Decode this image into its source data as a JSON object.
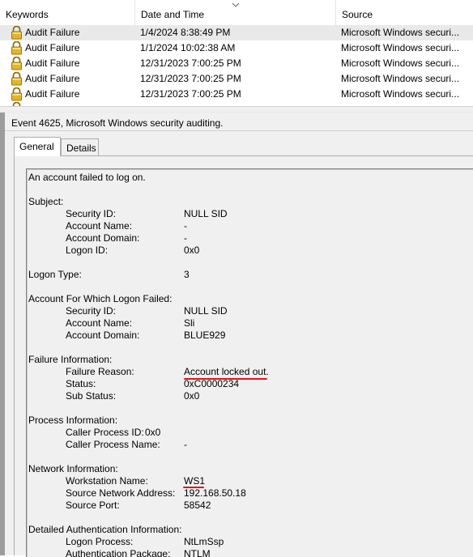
{
  "list": {
    "columns": {
      "keywords": "Keywords",
      "date_time": "Date and Time",
      "source": "Source"
    },
    "rows": [
      {
        "keywords": "Audit Failure",
        "date_time": "1/4/2024 8:38:49 PM",
        "source": "Microsoft Windows securi...",
        "selected": true
      },
      {
        "keywords": "Audit Failure",
        "date_time": "1/1/2024 10:02:38 AM",
        "source": "Microsoft Windows securi...",
        "selected": false
      },
      {
        "keywords": "Audit Failure",
        "date_time": "12/31/2023 7:00:25 PM",
        "source": "Microsoft Windows securi...",
        "selected": false
      },
      {
        "keywords": "Audit Failure",
        "date_time": "12/31/2023 7:00:25 PM",
        "source": "Microsoft Windows securi...",
        "selected": false
      },
      {
        "keywords": "Audit Failure",
        "date_time": "12/31/2023 7:00:25 PM",
        "source": "Microsoft Windows securi...",
        "selected": false
      }
    ],
    "row_icon": "padlock-icon",
    "sort_icon": "chevron-down-icon"
  },
  "detail": {
    "event_title": "Event 4625, Microsoft Windows security auditing.",
    "tabs": {
      "general": "General",
      "details": "Details"
    },
    "message": {
      "intro": "An account failed to log on.",
      "subject": {
        "heading": "Subject:",
        "security_id_label": "Security ID:",
        "security_id": "NULL SID",
        "account_name_label": "Account Name:",
        "account_name": "-",
        "account_domain_label": "Account Domain:",
        "account_domain": "-",
        "logon_id_label": "Logon ID:",
        "logon_id": "0x0"
      },
      "logon_type_label": "Logon Type:",
      "logon_type": "3",
      "account_failed": {
        "heading": "Account For Which Logon Failed:",
        "security_id_label": "Security ID:",
        "security_id": "NULL SID",
        "account_name_label": "Account Name:",
        "account_name": "Sli",
        "account_domain_label": "Account Domain:",
        "account_domain": "BLUE929"
      },
      "failure": {
        "heading": "Failure Information:",
        "reason_label": "Failure Reason:",
        "reason": "Account locked out.",
        "status_label": "Status:",
        "status": "0xC0000234",
        "sub_status_label": "Sub Status:",
        "sub_status": "0x0"
      },
      "process": {
        "heading": "Process Information:",
        "caller_pid_label": "Caller Process ID:",
        "caller_pid": "0x0",
        "caller_name_label": "Caller Process Name:",
        "caller_name": "-"
      },
      "network": {
        "heading": "Network Information:",
        "workstation_label": "Workstation Name:",
        "workstation": "WS1",
        "src_addr_label": "Source Network Address:",
        "src_addr": "192.168.50.18",
        "src_port_label": "Source Port:",
        "src_port": "58542"
      },
      "auth": {
        "heading": "Detailed Authentication Information:",
        "logon_process_label": "Logon Process:",
        "logon_process": "NtLmSsp",
        "auth_package_label": "Authentication Package:",
        "auth_package": "NTLM"
      }
    },
    "annotation_color": "#e0141e"
  }
}
